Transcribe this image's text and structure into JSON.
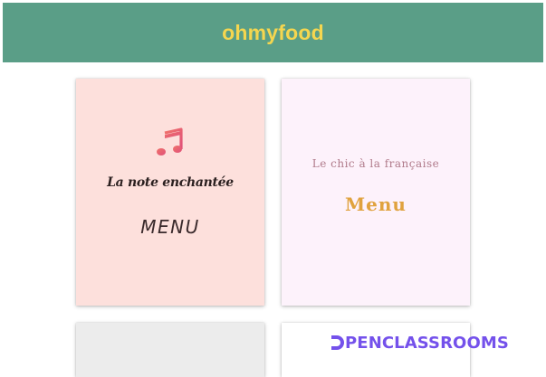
{
  "header": {
    "brand": "ohmyfood"
  },
  "cards": [
    {
      "icon": "music-note-icon",
      "title": "La note enchantée",
      "menu_label": "MENU"
    },
    {
      "title": "Le chic à la française",
      "menu_label": "Menu"
    },
    {},
    {}
  ],
  "watermark": {
    "text": "PENCLASSROOMS",
    "logo": "openclassrooms-logo"
  },
  "colors": {
    "header_bg": "#5a9e87",
    "brand": "#f5d64f",
    "card1_bg": "#fde0dc",
    "card2_bg": "#fdf2fb",
    "card3_bg": "#ececec",
    "card2_menu": "#e0a23e",
    "card2_title": "#b07a8a",
    "watermark": "#7451eb"
  }
}
